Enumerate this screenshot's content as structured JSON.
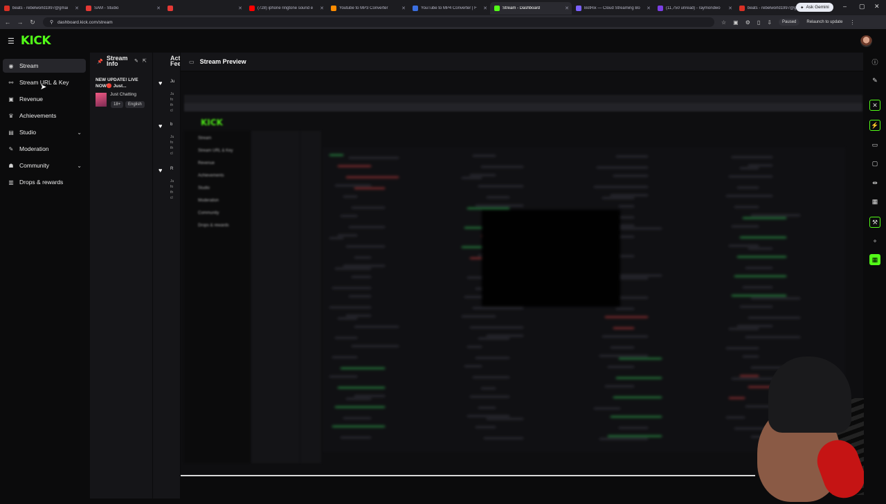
{
  "browser": {
    "tabs": [
      {
        "title": "beats - rebelworld1997@gmai",
        "favicon_color": "#d93025"
      },
      {
        "title": "SAM - Studio",
        "favicon_color": "#e53935"
      },
      {
        "title": "",
        "favicon_color": "#e53935"
      },
      {
        "title": "(728) iphone ringtone sound e",
        "favicon_color": "#ff0000"
      },
      {
        "title": "Youtube to MP3 Converter",
        "favicon_color": "#ff8c00"
      },
      {
        "title": "YouTube to MP4 Converter | F",
        "favicon_color": "#3b6fe0"
      },
      {
        "title": "Stream - Dashboard",
        "favicon_color": "#53fc18"
      },
      {
        "title": "BotRix — Cloud Streaming Bo",
        "favicon_color": "#7b61ff"
      },
      {
        "title": "(11,750 unread) - raymondwo",
        "favicon_color": "#7b3fe4"
      },
      {
        "title": "beats - rebelworld1997@gmai",
        "favicon_color": "#d93025"
      }
    ],
    "active_tab_index": 6,
    "new_tab": "+",
    "ask_gemini": "Ask Gemini",
    "url": "dashboard.kick.com/stream",
    "paused": "Paused",
    "relaunch": "Relaunch to update"
  },
  "header": {
    "logo": "KICK"
  },
  "sidebar": {
    "items": [
      {
        "label": "Stream",
        "icon": "broadcast-icon",
        "glyph": "◉",
        "active": true,
        "chevron": false
      },
      {
        "label": "Stream URL & Key",
        "icon": "link-icon",
        "glyph": "⚯",
        "active": false,
        "chevron": false
      },
      {
        "label": "Revenue",
        "icon": "wallet-icon",
        "glyph": "▣",
        "active": false,
        "chevron": false
      },
      {
        "label": "Achievements",
        "icon": "trophy-icon",
        "glyph": "♛",
        "active": false,
        "chevron": false
      },
      {
        "label": "Studio",
        "icon": "studio-icon",
        "glyph": "▤",
        "active": false,
        "chevron": true
      },
      {
        "label": "Moderation",
        "icon": "wrench-icon",
        "glyph": "✎",
        "active": false,
        "chevron": false
      },
      {
        "label": "Community",
        "icon": "community-icon",
        "glyph": "☗",
        "active": false,
        "chevron": true
      },
      {
        "label": "Drops & rewards",
        "icon": "gift-icon",
        "glyph": "▥",
        "active": false,
        "chevron": false
      }
    ]
  },
  "stream_info": {
    "header": "Stream Info",
    "title": "NEW UPDATE! LIVE NOW🔴 Just...",
    "category": "Just Chatting",
    "tags": [
      "18+",
      "English"
    ]
  },
  "activity_feed": {
    "header": "Activity Feed",
    "events": [
      {
        "initial": "Ju",
        "lines": [
          "Ju",
          "fo",
          "th",
          "cl"
        ]
      },
      {
        "initial": "b",
        "lines": [
          "Ju",
          "fo",
          "th",
          "cl"
        ]
      },
      {
        "initial": "R",
        "lines": [
          "Ju",
          "fo",
          "th",
          "cl"
        ]
      }
    ]
  },
  "preview": {
    "header": "Stream Preview",
    "inner_sidebar": [
      "Stream",
      "Stream URL & Key",
      "Revenue",
      "Achievements",
      "Studio",
      "Moderation",
      "Community",
      "Drops & rewards"
    ],
    "inner_logo": "KICK"
  },
  "colors": {
    "brand": "#53fc18",
    "background": "#0b0b0c",
    "panel": "#151518"
  }
}
